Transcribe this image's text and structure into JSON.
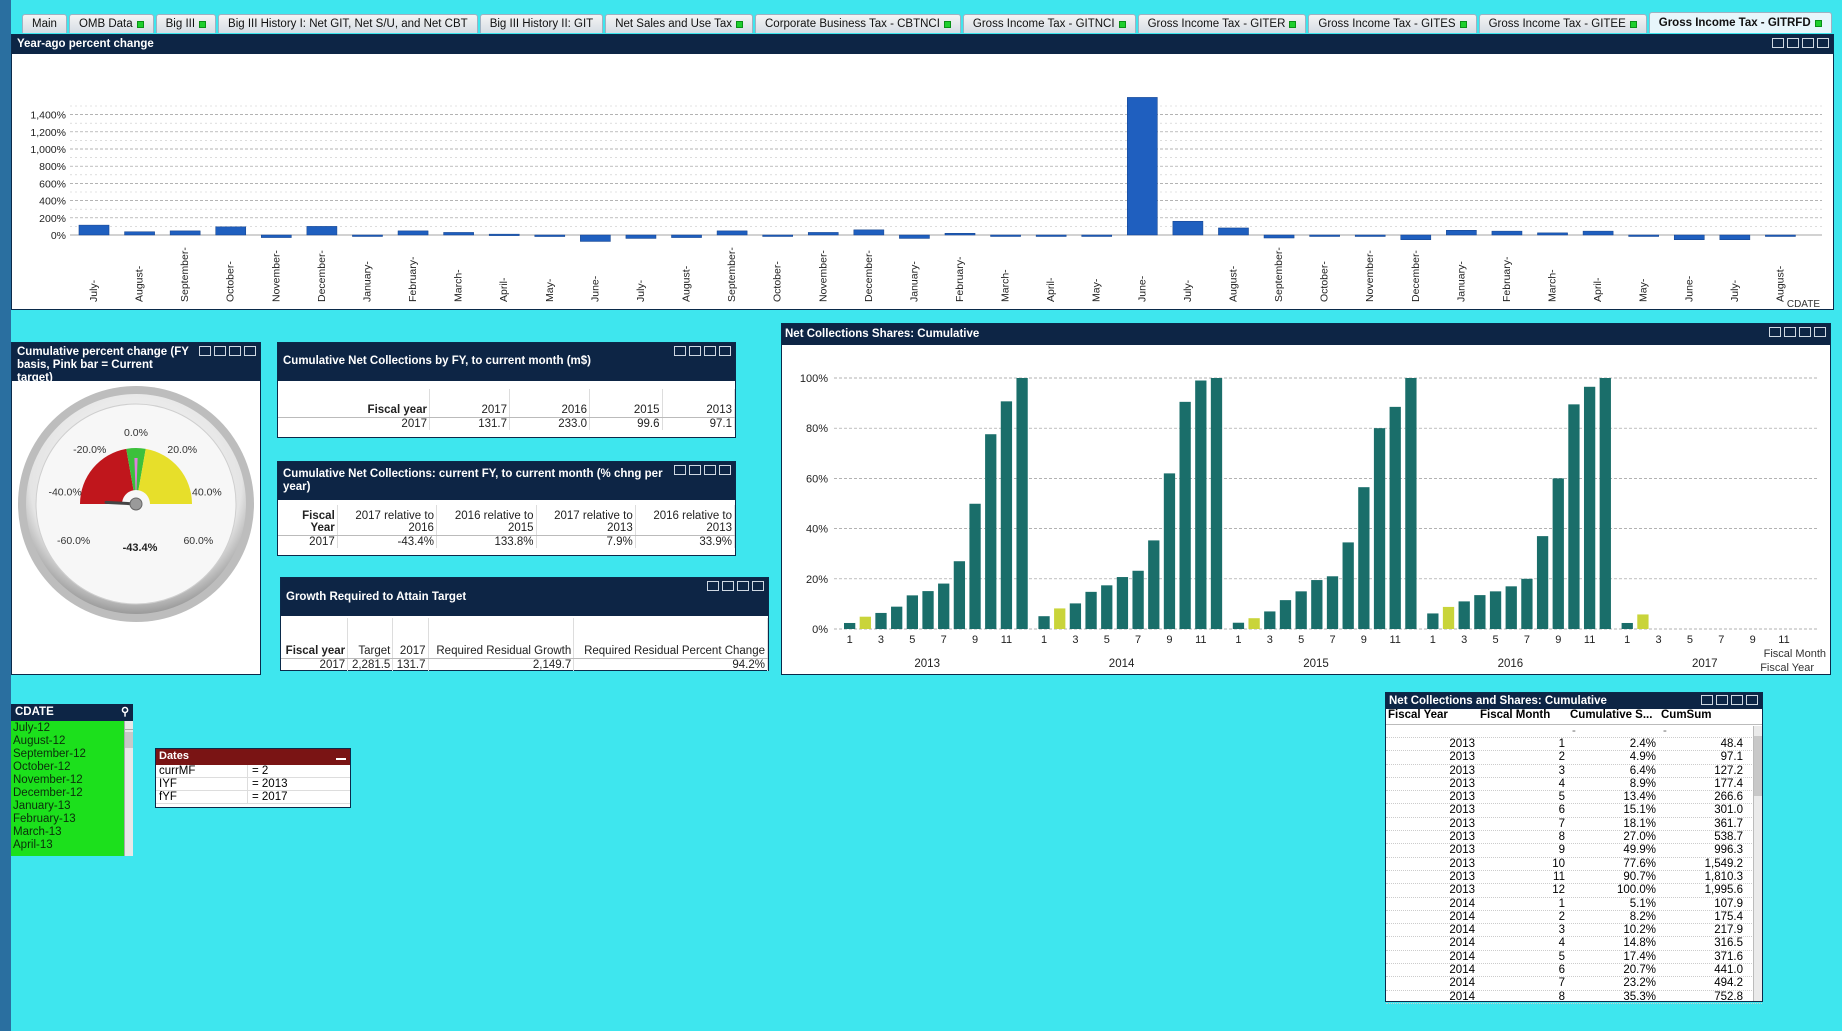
{
  "tabs": [
    {
      "label": "Main",
      "dot": false,
      "active": false
    },
    {
      "label": "OMB Data",
      "dot": true,
      "active": false
    },
    {
      "label": "Big III",
      "dot": true,
      "active": false
    },
    {
      "label": "Big III History I: Net GIT, Net S/U, and Net CBT",
      "dot": false,
      "active": false
    },
    {
      "label": "Big III History II: GIT",
      "dot": false,
      "active": false
    },
    {
      "label": "Net Sales and Use Tax",
      "dot": true,
      "active": false
    },
    {
      "label": "Corporate Business Tax - CBTNCI",
      "dot": true,
      "active": false
    },
    {
      "label": "Gross Income Tax - GITNCI",
      "dot": true,
      "active": false
    },
    {
      "label": "Gross Income Tax - GITER",
      "dot": true,
      "active": false
    },
    {
      "label": "Gross Income Tax - GITES",
      "dot": true,
      "active": false
    },
    {
      "label": "Gross Income Tax - GITEE",
      "dot": true,
      "active": false
    },
    {
      "label": "Gross Income Tax - GITRFD",
      "dot": true,
      "active": true
    }
  ],
  "yoy": {
    "title": "Year-ago percent change",
    "x_axis_label": "CDATE"
  },
  "gauge": {
    "title": "Cumulative percent change (FY basis, Pink bar = Current target)",
    "value_label": "-43.4%",
    "value": -43.4,
    "ticks": [
      "-60.0%",
      "-40.0%",
      "-20.0%",
      "0.0%",
      "20.0%",
      "40.0%",
      "60.0%"
    ],
    "colors": {
      "red": "#c0161c",
      "green": "#3cc03c",
      "yellow": "#e7df2a"
    }
  },
  "cum_fy": {
    "title": "Cumulative Net Collections by FY, to current month (m$)",
    "headers": [
      "Fiscal year",
      "2017",
      "2016",
      "2015",
      "2013"
    ],
    "row": [
      "2017",
      "131.7",
      "233.0",
      "99.6",
      "97.1"
    ]
  },
  "cum_pct": {
    "title": "Cumulative Net Collections: current FY, to current month (% chng per year)",
    "headers": [
      "Fiscal Year",
      "2017 relative to 2016",
      "2016 relative to 2015",
      "2017 relative to 2013",
      "2016 relative to 2013"
    ],
    "row": [
      "2017",
      "-43.4%",
      "133.8%",
      "7.9%",
      "33.9%"
    ]
  },
  "growth": {
    "title": "Growth Required to Attain Target",
    "headers": [
      "Fiscal year",
      "Target",
      "2017",
      "Required Residual Growth",
      "Required Residual Percent Change"
    ],
    "row": [
      "2017",
      "2,281.5",
      "131.7",
      "2,149.7",
      "94.2%"
    ]
  },
  "shares_chart": {
    "title": "Net Collections Shares: Cumulative",
    "x_title_1": "Fiscal Month",
    "x_title_2": "Fiscal Year",
    "month_ticks": [
      "1",
      "3",
      "5",
      "7",
      "9",
      "11"
    ],
    "years": [
      "2013",
      "2014",
      "2015",
      "2016",
      "2017"
    ]
  },
  "cdate": {
    "title": "CDATE",
    "items": [
      "July-12",
      "August-12",
      "September-12",
      "October-12",
      "November-12",
      "December-12",
      "January-13",
      "February-13",
      "March-13",
      "April-13"
    ]
  },
  "dates": {
    "title": "Dates",
    "rows": [
      {
        "k": "currMF",
        "v": "= 2"
      },
      {
        "k": "IYF",
        "v": "= 2013"
      },
      {
        "k": "fYF",
        "v": "= 2017"
      }
    ]
  },
  "table": {
    "title": "Net Collections and Shares: Cumulative",
    "headers": [
      "Fiscal Year",
      "Fiscal Month",
      "Cumulative S...",
      "CumSum"
    ],
    "subrow": [
      "",
      "",
      "-",
      "-"
    ],
    "rows": [
      [
        "2013",
        "1",
        "2.4%",
        "48.4"
      ],
      [
        "2013",
        "2",
        "4.9%",
        "97.1"
      ],
      [
        "2013",
        "3",
        "6.4%",
        "127.2"
      ],
      [
        "2013",
        "4",
        "8.9%",
        "177.4"
      ],
      [
        "2013",
        "5",
        "13.4%",
        "266.6"
      ],
      [
        "2013",
        "6",
        "15.1%",
        "301.0"
      ],
      [
        "2013",
        "7",
        "18.1%",
        "361.7"
      ],
      [
        "2013",
        "8",
        "27.0%",
        "538.7"
      ],
      [
        "2013",
        "9",
        "49.9%",
        "996.3"
      ],
      [
        "2013",
        "10",
        "77.6%",
        "1,549.2"
      ],
      [
        "2013",
        "11",
        "90.7%",
        "1,810.3"
      ],
      [
        "2013",
        "12",
        "100.0%",
        "1,995.6"
      ],
      [
        "2014",
        "1",
        "5.1%",
        "107.9"
      ],
      [
        "2014",
        "2",
        "8.2%",
        "175.4"
      ],
      [
        "2014",
        "3",
        "10.2%",
        "217.9"
      ],
      [
        "2014",
        "4",
        "14.8%",
        "316.5"
      ],
      [
        "2014",
        "5",
        "17.4%",
        "371.6"
      ],
      [
        "2014",
        "6",
        "20.7%",
        "441.0"
      ],
      [
        "2014",
        "7",
        "23.2%",
        "494.2"
      ],
      [
        "2014",
        "8",
        "35.3%",
        "752.8"
      ]
    ]
  },
  "chart_data": [
    {
      "type": "bar",
      "title": "Year-ago percent change",
      "xlabel": "CDATE",
      "ylabel": "",
      "ylim": [
        -100,
        1600
      ],
      "yticks": [
        "0%",
        "200%",
        "400%",
        "600%",
        "800%",
        "1,000%",
        "1,200%",
        "1,400%"
      ],
      "categories": [
        "July-",
        "August-",
        "September-",
        "October-",
        "November-",
        "December-",
        "January-",
        "February-",
        "March-",
        "April-",
        "May-",
        "June-",
        "July-",
        "August-",
        "September-",
        "October-",
        "November-",
        "December-",
        "January-",
        "February-",
        "March-",
        "April-",
        "May-",
        "June-",
        "July-",
        "August-",
        "September-",
        "October-",
        "November-",
        "December-",
        "January-",
        "February-",
        "March-",
        "April-",
        "May-",
        "June-",
        "July-",
        "August-"
      ],
      "values": [
        115,
        38,
        48,
        95,
        -30,
        100,
        -8,
        48,
        30,
        10,
        -18,
        -75,
        -40,
        -30,
        48,
        -8,
        30,
        60,
        -40,
        20,
        -5,
        -5,
        -5,
        1600,
        160,
        82,
        -35,
        -5,
        -5,
        -55,
        55,
        45,
        25,
        45,
        -12,
        -55,
        -55,
        -5
      ],
      "colors": {
        "bar": "#1f5fbf",
        "bar_light": "#3b86e0"
      }
    },
    {
      "type": "bar",
      "title": "Net Collections Shares: Cumulative",
      "xlabel": "Fiscal Month",
      "ylabel": "",
      "ylim": [
        0,
        100
      ],
      "yticks": [
        "0%",
        "20%",
        "40%",
        "60%",
        "80%",
        "100%"
      ],
      "series": [
        {
          "name": "2013",
          "values": [
            2.4,
            4.9,
            6.4,
            8.9,
            13.4,
            15.1,
            18.1,
            27.0,
            49.9,
            77.6,
            90.7,
            100.0
          ]
        },
        {
          "name": "2014",
          "values": [
            5.1,
            8.2,
            10.2,
            14.8,
            17.4,
            20.7,
            23.2,
            35.3,
            62.0,
            90.5,
            99.0,
            100.0
          ]
        },
        {
          "name": "2015",
          "values": [
            2.5,
            4.3,
            7.0,
            11.5,
            15.0,
            19.5,
            21.0,
            34.5,
            56.5,
            80.0,
            88.5,
            100.0
          ]
        },
        {
          "name": "2016",
          "values": [
            6.2,
            8.8,
            11.0,
            13.5,
            15.0,
            17.0,
            20.0,
            37.0,
            60.0,
            89.5,
            96.5,
            100.0
          ]
        },
        {
          "name": "2017",
          "values": [
            2.4,
            5.8
          ]
        }
      ],
      "highlight_month": 2,
      "colors": {
        "bar": "#1a6e6a",
        "highlight": "#c9d43a"
      }
    }
  ]
}
